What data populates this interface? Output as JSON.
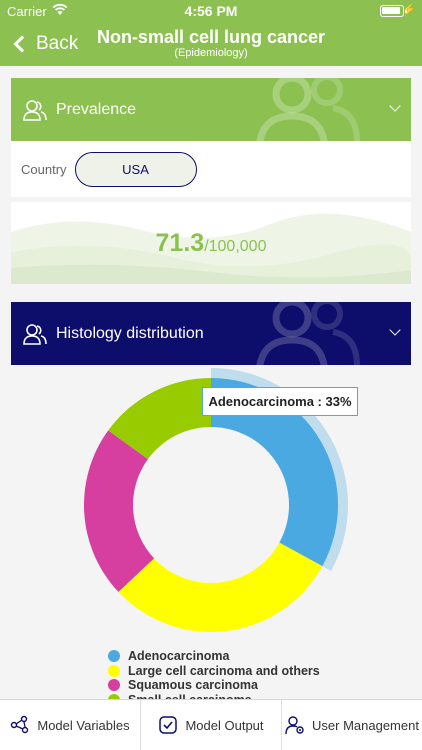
{
  "status": {
    "carrier": "Carrier",
    "time": "4:56 PM"
  },
  "nav": {
    "back_label": "Back",
    "title": "Non-small cell lung cancer",
    "subtitle": "(Epidemiology)"
  },
  "prevalence": {
    "header": "Prevalence",
    "country_label": "Country",
    "country_value": "USA",
    "rate_value": "71.3",
    "rate_unit": "/100,000"
  },
  "histology": {
    "header": "Histology distribution",
    "tooltip": "Adenocarcinoma  : 33%"
  },
  "chart_data": {
    "type": "pie",
    "categories": [
      "Adenocarcinoma",
      "Large cell carcinoma and others",
      "Squamous carcinoma",
      "Small cell carcinoma"
    ],
    "values": [
      33,
      30,
      22,
      15
    ],
    "colors": [
      "#4aa9e0",
      "#ffff00",
      "#d63ea0",
      "#99cc00"
    ],
    "highlighted": "Adenocarcinoma",
    "donut": true,
    "legend_position": "bottom"
  },
  "tabs": [
    {
      "label": "Model Variables",
      "icon": "network-icon"
    },
    {
      "label": "Model Output",
      "icon": "checkbox-icon"
    },
    {
      "label": "User Management",
      "icon": "user-gear-icon"
    }
  ]
}
